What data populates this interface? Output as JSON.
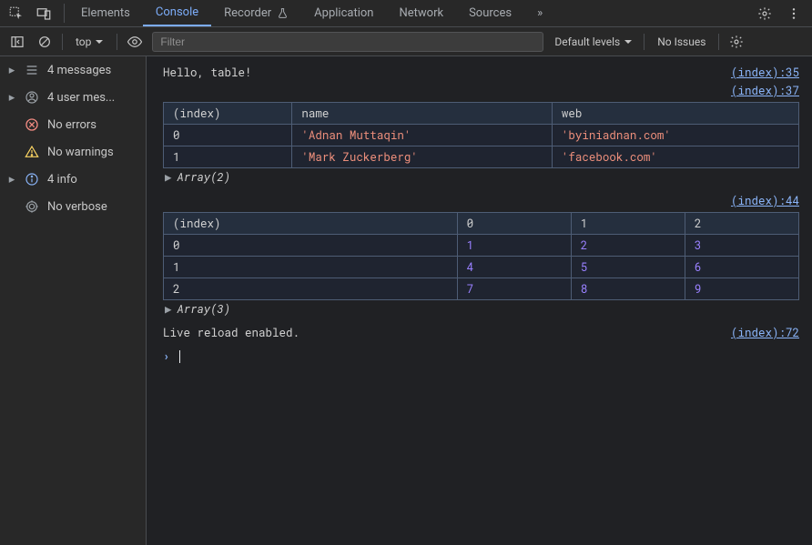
{
  "tabs": {
    "items": [
      "Elements",
      "Console",
      "Recorder",
      "Application",
      "Network",
      "Sources"
    ],
    "activeIndex": 1,
    "recorderHasBadge": true,
    "more": "»"
  },
  "toolbar": {
    "context": "top",
    "filterPlaceholder": "Filter",
    "levels": "Default levels",
    "issues": "No Issues"
  },
  "sidebar": {
    "items": [
      {
        "kind": "msg",
        "expandable": true,
        "label": "4 messages"
      },
      {
        "kind": "user",
        "expandable": true,
        "label": "4 user mes..."
      },
      {
        "kind": "err",
        "expandable": false,
        "label": "No errors"
      },
      {
        "kind": "warn",
        "expandable": false,
        "label": "No warnings"
      },
      {
        "kind": "info",
        "expandable": true,
        "label": "4 info"
      },
      {
        "kind": "verbose",
        "expandable": false,
        "label": "No verbose"
      }
    ]
  },
  "console": {
    "line1_text": "Hello, table!",
    "line1_src": "(index):35",
    "src2": "(index):37",
    "table1": {
      "headers": [
        "(index)",
        "name",
        "web"
      ],
      "rows": [
        [
          "0",
          "'Adnan Muttaqin'",
          "'byiniadnan.com'"
        ],
        [
          "1",
          "'Mark Zuckerberg'",
          "'facebook.com'"
        ]
      ],
      "expander": "Array(2)"
    },
    "src3": "(index):44",
    "table2": {
      "headers": [
        "(index)",
        "0",
        "1",
        "2"
      ],
      "rows": [
        [
          "0",
          "1",
          "2",
          "3"
        ],
        [
          "1",
          "4",
          "5",
          "6"
        ],
        [
          "2",
          "7",
          "8",
          "9"
        ]
      ],
      "expander": "Array(3)"
    },
    "line_live": "Live reload enabled.",
    "src_live": "(index):72"
  }
}
